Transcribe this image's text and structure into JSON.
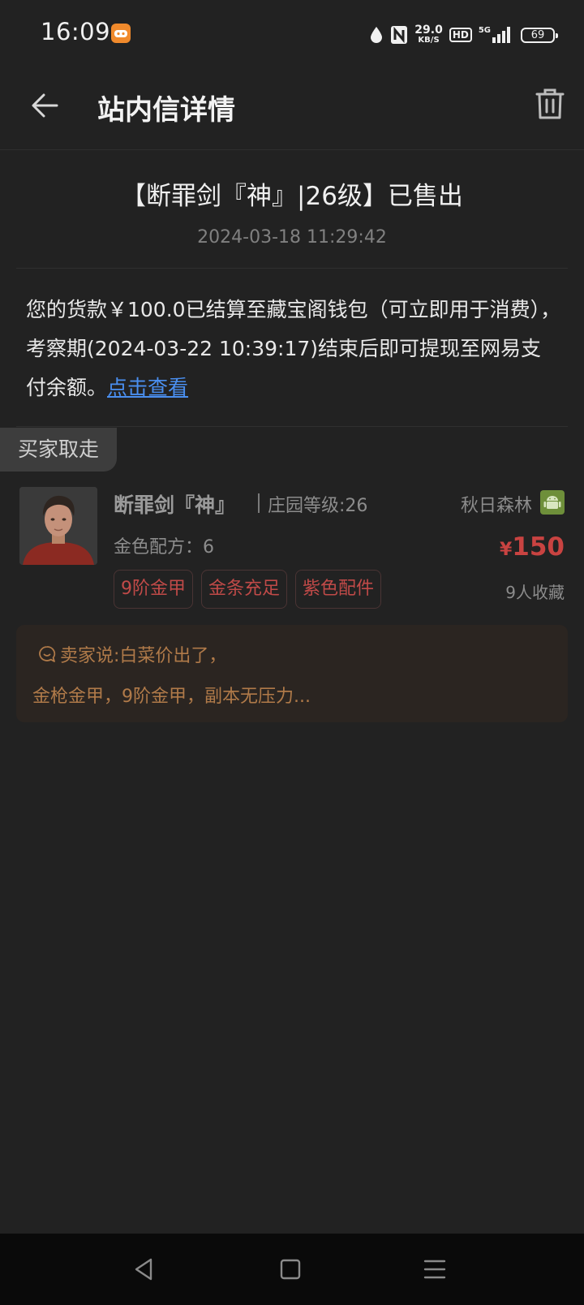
{
  "status_bar": {
    "time": "16:09",
    "net_speed_value": "29.0",
    "net_speed_unit": "KB/S",
    "hd_label": "HD",
    "network_label": "5G",
    "battery": "69",
    "icons": [
      "game-app-icon",
      "water-drop-icon",
      "nfc-icon",
      "hd-icon",
      "signal-icon",
      "battery-icon"
    ]
  },
  "header": {
    "title": "站内信详情",
    "back_icon": "back-arrow-icon",
    "delete_icon": "trash-icon"
  },
  "message": {
    "title": "【断罪剑『神』|26级】已售出",
    "time": "2024-03-18 11:29:42",
    "body_text": "您的货款￥100.0已结算至藏宝阁钱包（可立即用于消费），考察期(2024-03-22 10:39:17)结束后即可提现至网易支付余额。",
    "link_text": "点击查看",
    "link_color": "#4a8ff0"
  },
  "product": {
    "buyer_tag": "买家取走",
    "name": "断罪剑『神』",
    "level": "庄园等级:26",
    "server": "秋日森林",
    "platform_icon": "android-icon",
    "gold_recipe": "金色配方：6",
    "price_symbol": "¥",
    "price_value": "150",
    "price_color": "#c94341",
    "tags": [
      "9阶金甲",
      "金条充足",
      "紫色配件"
    ],
    "favorites": "9人收藏"
  },
  "seller_note": {
    "line1": "卖家说:白菜价出了，",
    "line2": "金枪金甲，9阶金甲，副本无压力...",
    "icon": "chat-bubble-icon",
    "color": "#b07a49"
  },
  "nav_bar": {
    "icons": [
      "nav-back-icon",
      "nav-home-icon",
      "nav-menu-icon"
    ]
  }
}
